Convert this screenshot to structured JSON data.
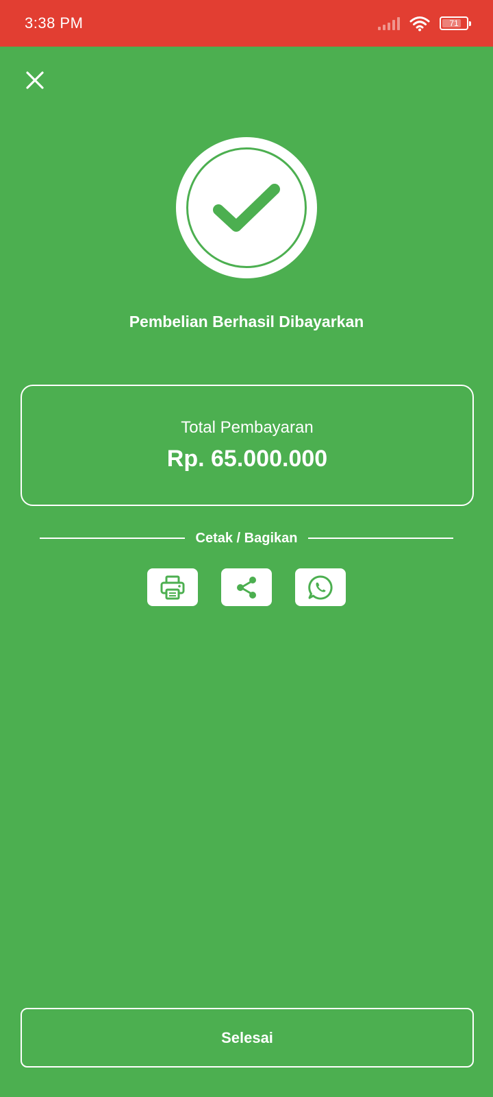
{
  "status_bar": {
    "time": "3:38 PM",
    "battery_level": "71",
    "background_color": "#E23E32"
  },
  "colors": {
    "background": "#4CAF50",
    "accent": "#4CAF50"
  },
  "icons": {
    "close": "close-icon",
    "success": "checkmark-icon",
    "print": "printer-icon",
    "share": "share-icon",
    "whatsapp": "whatsapp-icon"
  },
  "header": {
    "success_title": "Pembelian Berhasil Dibayarkan"
  },
  "summary": {
    "total_label": "Total Pembayaran",
    "total_amount": "Rp. 65.000.000"
  },
  "share": {
    "title": "Cetak / Bagikan"
  },
  "footer": {
    "finish_label": "Selesai"
  }
}
